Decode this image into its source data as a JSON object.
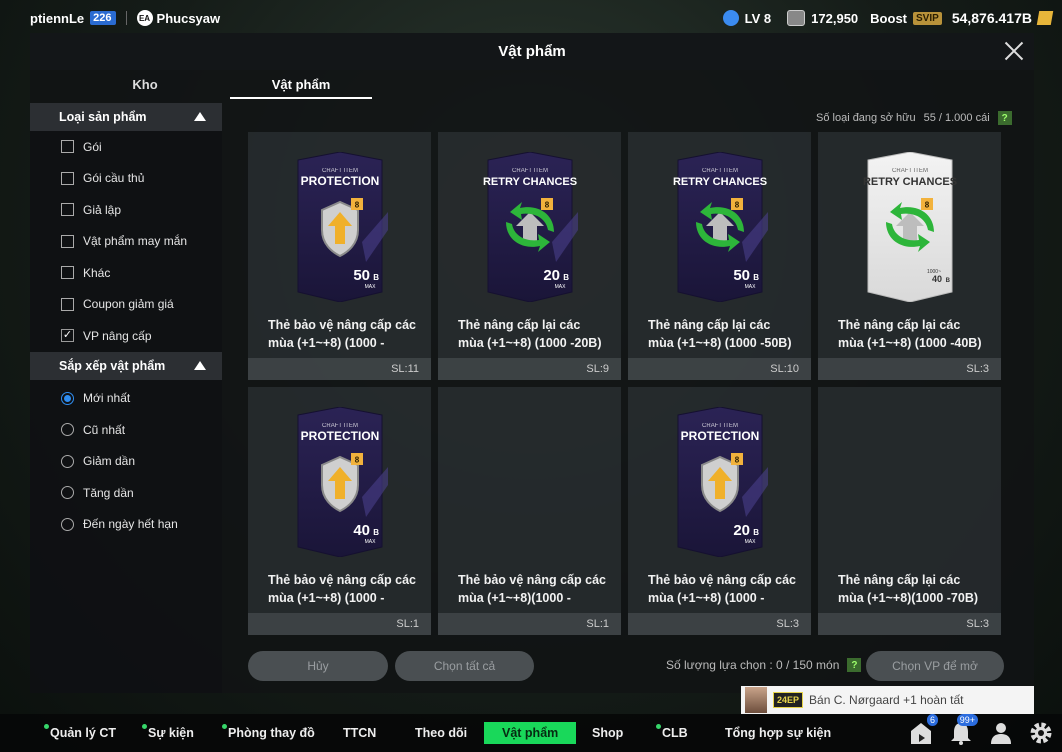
{
  "topbar": {
    "username": "ptiennLe",
    "user_level": "226",
    "ea_name": "Phucsyaw",
    "lv": "LV 8",
    "coins": "172,950",
    "boost_label": "Boost",
    "svip": "SVIP",
    "bp": "54,876.417B"
  },
  "modal": {
    "title": "Vật phẩm",
    "tabs": [
      "Kho",
      "Vật phẩm"
    ]
  },
  "sidebar": {
    "filter_title": "Loại sản phẩm",
    "filters": [
      {
        "label": "Gói",
        "checked": false
      },
      {
        "label": "Gói cầu thủ",
        "checked": false
      },
      {
        "label": "Giả lập",
        "checked": false
      },
      {
        "label": "Vật phẩm may mắn",
        "checked": false
      },
      {
        "label": "Khác",
        "checked": false
      },
      {
        "label": "Coupon giảm giá",
        "checked": false
      },
      {
        "label": "VP nâng cấp",
        "checked": true
      }
    ],
    "sort_title": "Sắp xếp vật phẩm",
    "sorts": [
      {
        "label": "Mới nhất",
        "selected": true
      },
      {
        "label": "Cũ nhất",
        "selected": false
      },
      {
        "label": "Giảm dần",
        "selected": false
      },
      {
        "label": "Tăng dần",
        "selected": false
      },
      {
        "label": "Đến ngày hết hạn",
        "selected": false
      }
    ]
  },
  "owned": {
    "label": "Số loại đang sở hữu",
    "value": "55 / 1.000 cái",
    "help": "?"
  },
  "items": [
    {
      "name": "Thẻ bảo vệ nâng cấp các mùa (+1~+8) (1000 -",
      "qty": "SL:11",
      "card_title": "PROTECTION",
      "craft": "CRAFT ITEM",
      "value": "50",
      "unit": "B",
      "max": "MAX",
      "kind": "protection",
      "style": "dark"
    },
    {
      "name": "Thẻ nâng cấp lại các mùa (+1~+8) (1000 -20B)",
      "qty": "SL:9",
      "card_title": "RETRY CHANCES",
      "craft": "CRAFT ITEM",
      "value": "20",
      "unit": "B",
      "max": "MAX",
      "kind": "retry",
      "style": "dark"
    },
    {
      "name": "Thẻ nâng cấp lại các mùa (+1~+8) (1000 -50B)",
      "qty": "SL:10",
      "card_title": "RETRY CHANCES",
      "craft": "CRAFT ITEM",
      "value": "50",
      "unit": "B",
      "max": "MAX",
      "kind": "retry",
      "style": "dark"
    },
    {
      "name": "Thẻ nâng cấp lại các mùa (+1~+8) (1000 -40B)",
      "qty": "SL:3",
      "card_title": "RETRY CHANCES",
      "craft": "CRAFT ITEM",
      "value": "40",
      "unit": "B",
      "max": "1000~",
      "kind": "retry",
      "style": "white"
    },
    {
      "name": "Thẻ bảo vệ nâng cấp các mùa (+1~+8) (1000 -",
      "qty": "SL:1",
      "card_title": "PROTECTION",
      "craft": "CRAFT ITEM",
      "value": "40",
      "unit": "B",
      "max": "MAX",
      "kind": "protection",
      "style": "dark"
    },
    {
      "name": "Thẻ bảo vệ nâng cấp các mùa (+1~+8)(1000 -",
      "qty": "SL:1",
      "card_title": "",
      "craft": "",
      "value": "",
      "unit": "",
      "max": "",
      "kind": "none",
      "style": "none"
    },
    {
      "name": "Thẻ bảo vệ nâng cấp các mùa (+1~+8) (1000 -",
      "qty": "SL:3",
      "card_title": "PROTECTION",
      "craft": "CRAFT ITEM",
      "value": "20",
      "unit": "B",
      "max": "MAX",
      "kind": "protection",
      "style": "dark"
    },
    {
      "name": "Thẻ nâng cấp lại các mùa (+1~+8)(1000 -70B)",
      "qty": "SL:3",
      "card_title": "",
      "craft": "",
      "value": "",
      "unit": "",
      "max": "",
      "kind": "none",
      "style": "none"
    }
  ],
  "footer": {
    "cancel": "Hủy",
    "select_all": "Chọn tất cả",
    "selected_label": "Số lượng lựa chọn : 0 / 150 món",
    "help": "?",
    "open_selected": "Chọn VP để mở"
  },
  "notification": {
    "ovr": "24EP",
    "text": "Bán C. Nørgaard +1 hoàn tất"
  },
  "bottomnav": {
    "items": [
      {
        "label": "Quản lý CT",
        "dot": true
      },
      {
        "label": "Sự kiện",
        "dot": true
      },
      {
        "label": "Phòng thay đồ",
        "dot": true
      },
      {
        "label": "TTCN",
        "dot": false
      },
      {
        "label": "Theo dõi",
        "dot": false
      },
      {
        "label": "Vật phẩm",
        "dot": false,
        "active": true
      },
      {
        "label": "Shop",
        "dot": false
      },
      {
        "label": "CLB",
        "dot": true
      },
      {
        "label": "Tổng hợp sự kiện",
        "dot": false
      }
    ],
    "badges": {
      "shop": "6",
      "notifications": "99+"
    }
  },
  "colors": {
    "accent_green": "#19d85a",
    "card_dark": "#2b2355",
    "bp_gold": "#e7b53a",
    "svip": "#b8923a"
  }
}
